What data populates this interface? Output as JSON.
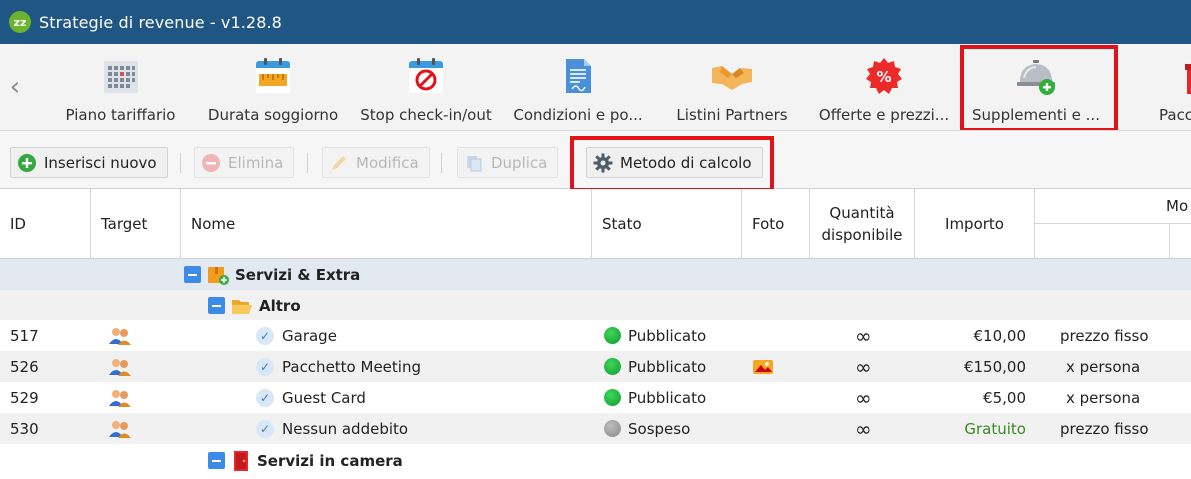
{
  "window": {
    "title": "Strategie di revenue - v1.28.8",
    "logo_text": "zz"
  },
  "ribbon": {
    "tabs": [
      {
        "label": "Piano tariffario",
        "icon": "calendar-grid-icon"
      },
      {
        "label": "Durata soggiorno",
        "icon": "calendar-ruler-icon"
      },
      {
        "label": "Stop check-in/out",
        "icon": "calendar-stop-icon"
      },
      {
        "label": "Condizioni e po...",
        "icon": "document-icon"
      },
      {
        "label": "Listini Partners",
        "icon": "handshake-icon"
      },
      {
        "label": "Offerte e prezzi...",
        "icon": "percent-badge-icon"
      },
      {
        "label": "Supplementi e ...",
        "icon": "service-bell-icon"
      },
      {
        "label": "Pacc",
        "icon": "gift-icon"
      }
    ]
  },
  "toolbar": {
    "insert": "Inserisci nuovo",
    "delete": "Elimina",
    "edit": "Modifica",
    "duplicate": "Duplica",
    "calc_method": "Metodo di calcolo"
  },
  "grid": {
    "headers": {
      "id": "ID",
      "target": "Target",
      "name": "Nome",
      "status": "Stato",
      "photo": "Foto",
      "qty": "Quantità disponibile",
      "amount": "Importo",
      "mode": "Mo"
    },
    "groups": {
      "servizi": "Servizi & Extra",
      "altro": "Altro",
      "camera": "Servizi in camera"
    },
    "rows": [
      {
        "id": "517",
        "name": "Garage",
        "status": "Pubblicato",
        "status_color": "#1aae3a",
        "qty": "∞",
        "amount": "€10,00",
        "mode": "prezzo fisso",
        "photo": false
      },
      {
        "id": "526",
        "name": "Pacchetto Meeting",
        "status": "Pubblicato",
        "status_color": "#1aae3a",
        "qty": "∞",
        "amount": "€150,00",
        "mode": "x persona",
        "photo": true
      },
      {
        "id": "529",
        "name": "Guest Card",
        "status": "Pubblicato",
        "status_color": "#1aae3a",
        "qty": "∞",
        "amount": "€5,00",
        "mode": "x persona",
        "photo": false
      },
      {
        "id": "530",
        "name": "Nessun addebito",
        "status": "Sospeso",
        "status_color": "#9a9a9a",
        "qty": "∞",
        "amount": "Gratuito",
        "mode": "prezzo fisso",
        "photo": false
      }
    ]
  },
  "colors": {
    "titlebar": "#1f5683",
    "highlight": "#e0131b",
    "group_header": "#e3e9f0",
    "published": "#1aae3a",
    "suspended": "#9a9a9a"
  }
}
